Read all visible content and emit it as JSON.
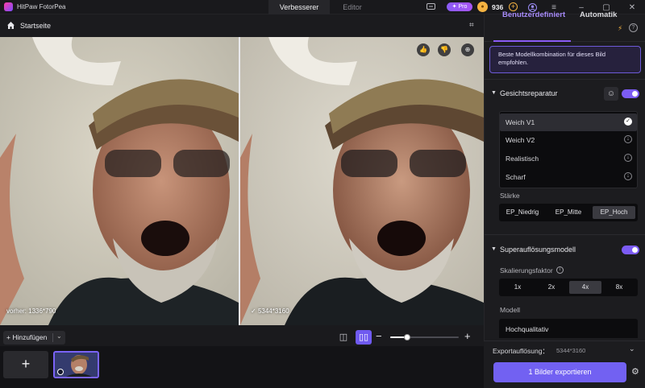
{
  "app": {
    "title": "HitPaw FotorPea"
  },
  "modes": {
    "active": "Verbesserer",
    "inactive": "Editor"
  },
  "header": {
    "pro_label": "Pro",
    "coins": "936"
  },
  "breadcrumb": {
    "label": "Startseite"
  },
  "panes": {
    "before_label": "vorher: 1336*790",
    "after_label": "5344*3160"
  },
  "toolbar": {
    "add_label": "Hinzufügen"
  },
  "zoom": {
    "level_fraction": 0.25
  },
  "panel": {
    "tab_custom": "Benutzerdefiniert",
    "tab_auto": "Automatik",
    "info": "Beste Modellkombination für dieses Bild empfohlen.",
    "face": {
      "title": "Gesichtsreparatur",
      "enabled": true,
      "models": [
        {
          "label": "Weich V1",
          "selected": true
        },
        {
          "label": "Weich V2",
          "selected": false
        },
        {
          "label": "Realistisch",
          "selected": false
        },
        {
          "label": "Scharf",
          "selected": false
        }
      ],
      "strength_label": "Stärke",
      "strength_options": [
        "EP_Niedrig",
        "EP_Mitte",
        "EP_Hoch"
      ],
      "strength_selected": "EP_Hoch"
    },
    "superres": {
      "title": "Superauflösungsmodell",
      "enabled": true,
      "scale_label": "Skalierungsfaktor",
      "scale_options": [
        "1x",
        "2x",
        "4x",
        "8x"
      ],
      "scale_selected": "4x",
      "model_label": "Modell",
      "model_value": "Hochqualitativ"
    },
    "export": {
      "res_label": "Exportauflösung：",
      "res_value": "5344*3160",
      "button": "1 Bilder exportieren"
    }
  },
  "colors": {
    "accent": "#7c5cf5",
    "bg": "#131316",
    "panel": "#1c1c1f"
  }
}
